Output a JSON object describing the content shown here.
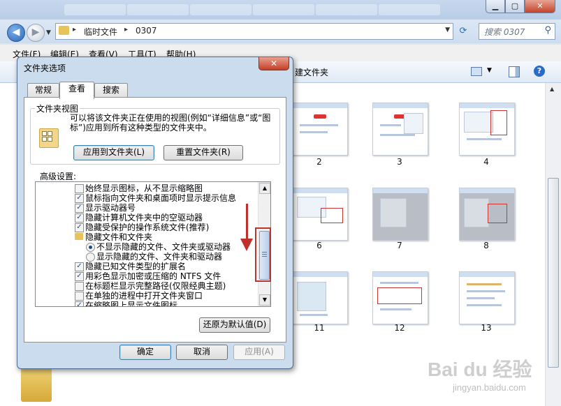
{
  "explorer": {
    "address": {
      "crumbs": [
        "临时文件",
        "0307"
      ]
    },
    "search_placeholder": "搜索 0307",
    "menu": [
      "文件(F)",
      "编辑(E)",
      "查看(V)",
      "工具(T)",
      "帮助(H)"
    ],
    "toolbar_new_folder": "建文件夹",
    "thumbnails": [
      {
        "caption": "2"
      },
      {
        "caption": "3"
      },
      {
        "caption": "4"
      },
      {
        "caption": "6"
      },
      {
        "caption": "7"
      },
      {
        "caption": "8"
      },
      {
        "caption": "11"
      },
      {
        "caption": "12"
      },
      {
        "caption": "13"
      }
    ],
    "watermark": "Bai du 经验",
    "watermark_url": "jingyan.baidu.com"
  },
  "dialog": {
    "title": "文件夹选项",
    "close_glyph": "✕",
    "tabs": [
      "常规",
      "查看",
      "搜索"
    ],
    "active_tab": "查看",
    "folder_views": {
      "label": "文件夹视图",
      "description": "可以将该文件夹正在使用的视图(例如“详细信息”或“图标”)应用到所有这种类型的文件夹中。",
      "apply_button": "应用到文件夹(L)",
      "reset_button": "重置文件夹(R)"
    },
    "advanced_label": "高级设置:",
    "advanced_items": [
      {
        "kind": "checkbox",
        "checked": false,
        "text": "始终显示图标，从不显示缩略图"
      },
      {
        "kind": "checkbox",
        "checked": true,
        "text": "鼠标指向文件夹和桌面项时显示提示信息"
      },
      {
        "kind": "checkbox",
        "checked": true,
        "text": "显示驱动器号"
      },
      {
        "kind": "checkbox",
        "checked": true,
        "text": "隐藏计算机文件夹中的空驱动器"
      },
      {
        "kind": "checkbox",
        "checked": true,
        "text": "隐藏受保护的操作系统文件(推荐)"
      },
      {
        "kind": "folder",
        "text": "隐藏文件和文件夹"
      },
      {
        "kind": "radio",
        "checked": true,
        "text": "不显示隐藏的文件、文件夹或驱动器"
      },
      {
        "kind": "radio",
        "checked": false,
        "text": "显示隐藏的文件、文件夹和驱动器"
      },
      {
        "kind": "checkbox",
        "checked": true,
        "text": "隐藏已知文件类型的扩展名"
      },
      {
        "kind": "checkbox",
        "checked": true,
        "text": "用彩色显示加密或压缩的 NTFS 文件"
      },
      {
        "kind": "checkbox",
        "checked": false,
        "text": "在标题栏显示完整路径(仅限经典主题)"
      },
      {
        "kind": "checkbox",
        "checked": false,
        "text": "在单独的进程中打开文件夹窗口"
      },
      {
        "kind": "checkbox",
        "checked": true,
        "text": "在缩略图上显示文件图标"
      }
    ],
    "restore_defaults_button": "还原为默认值(D)",
    "ok_button": "确定",
    "cancel_button": "取消",
    "apply_button": "应用(A)"
  },
  "colors": {
    "annotation_red": "#c0302a",
    "check_mark": "#1d4a84"
  }
}
